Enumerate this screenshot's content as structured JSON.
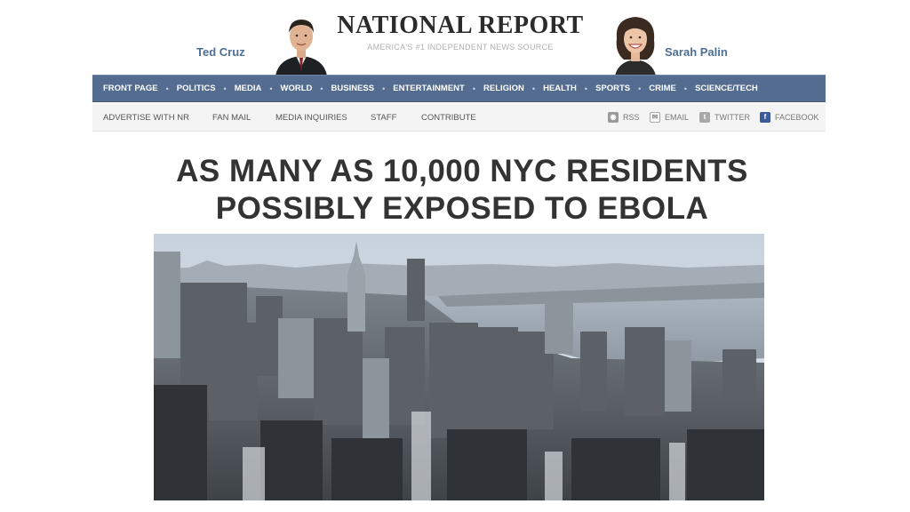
{
  "masthead": {
    "title": "NATIONAL REPORT",
    "tagline": "AMERICA'S #1 INDEPENDENT NEWS SOURCE",
    "left_pundit": "Ted Cruz",
    "right_pundit": "Sarah Palin"
  },
  "main_nav": {
    "items": [
      "FRONT PAGE",
      "POLITICS",
      "MEDIA",
      "WORLD",
      "BUSINESS",
      "ENTERTAINMENT",
      "RELIGION",
      "HEALTH",
      "SPORTS",
      "CRIME",
      "SCIENCE/TECH"
    ],
    "separator": "•"
  },
  "sub_nav": {
    "items": [
      "ADVERTISE WITH NR",
      "FAN MAIL",
      "MEDIA INQUIRIES",
      "STAFF",
      "CONTRIBUTE"
    ],
    "social": [
      {
        "label": "RSS",
        "icon": "rss-icon"
      },
      {
        "label": "EMAIL",
        "icon": "email-icon"
      },
      {
        "label": "TWITTER",
        "icon": "twitter-icon"
      },
      {
        "label": "FACEBOOK",
        "icon": "facebook-icon"
      }
    ]
  },
  "article": {
    "headline_line1": "AS MANY AS 10,000 NYC RESIDENTS",
    "headline_line2": "POSSIBLY EXPOSED TO EBOLA",
    "photo": "new-york-city-skyline-photo"
  },
  "colors": {
    "nav_bg": "#536c8f",
    "pundit_name": "#4d6e96",
    "headline": "#333333"
  }
}
